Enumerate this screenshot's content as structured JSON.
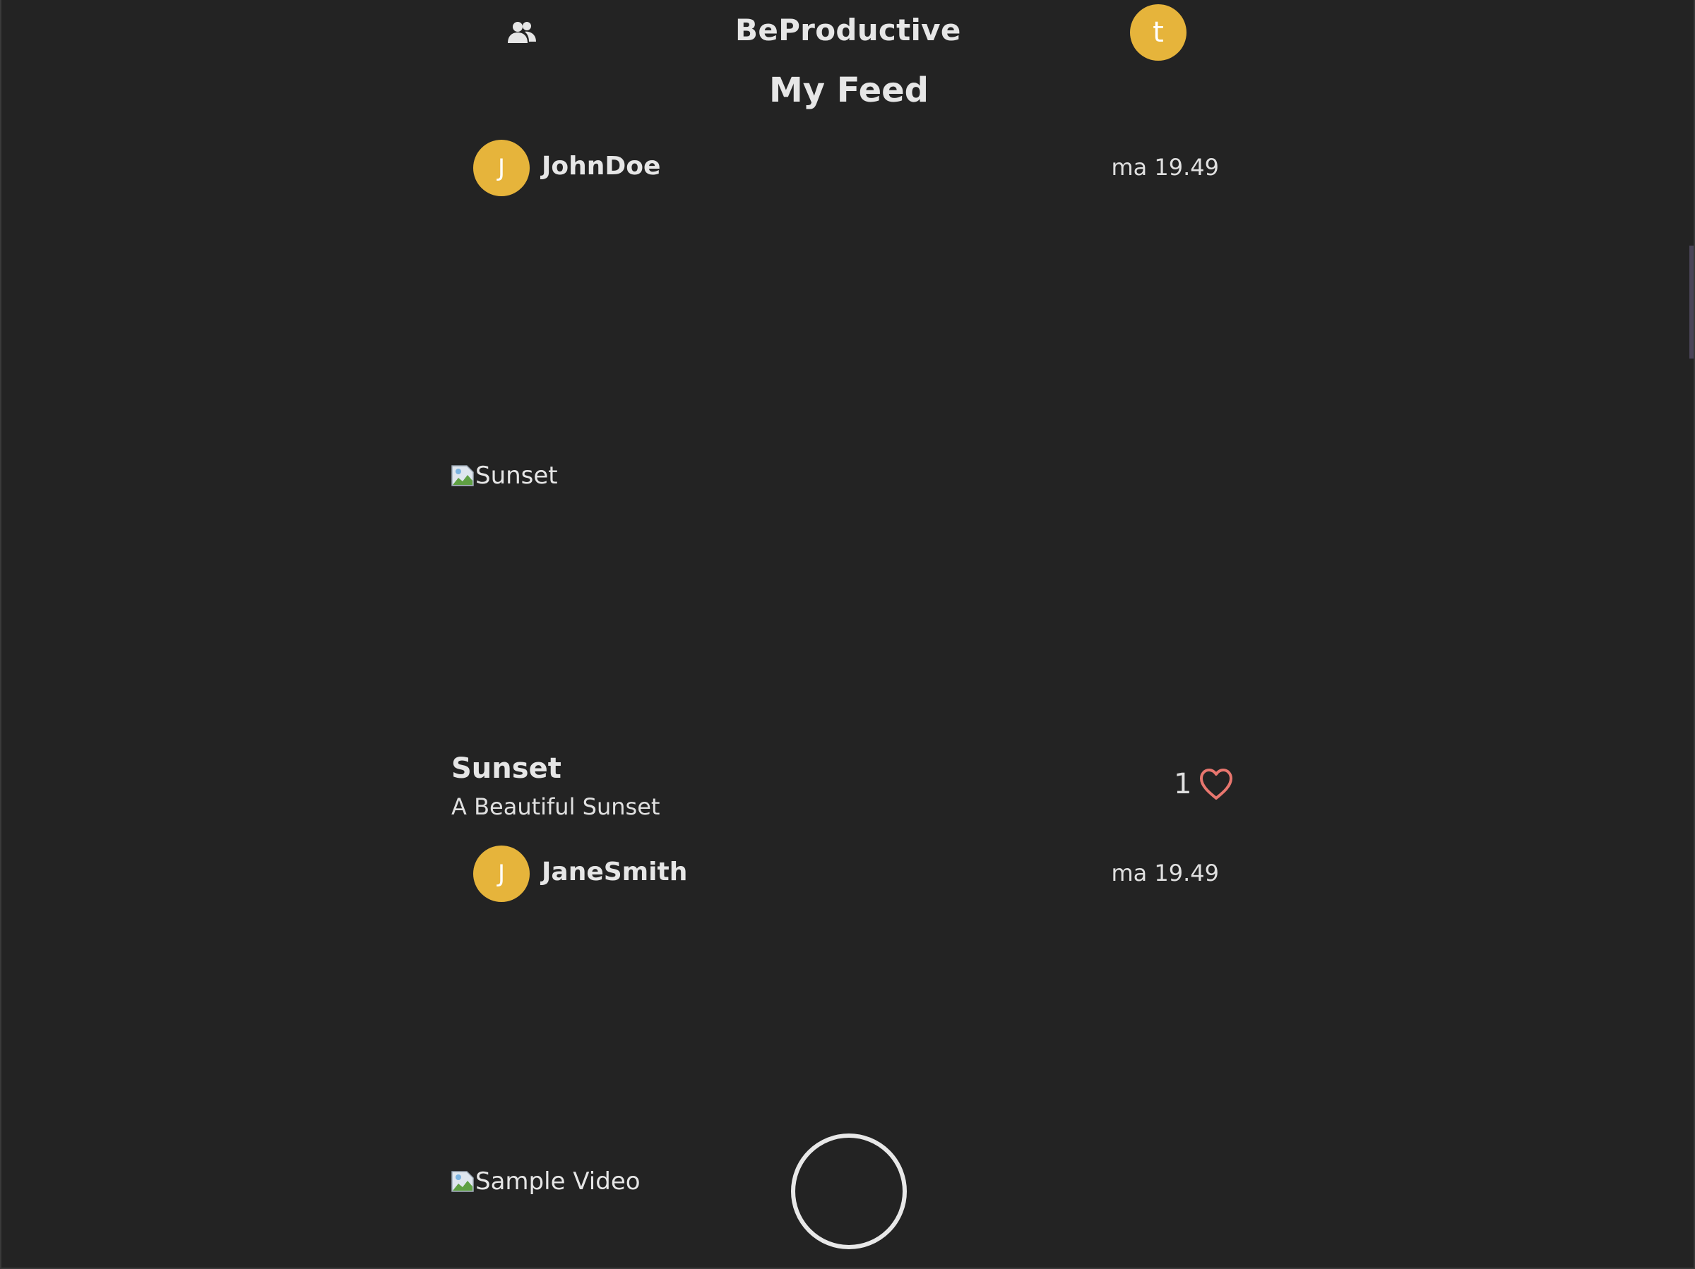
{
  "app": {
    "brand": "BeProductive",
    "user_initial": "t",
    "accent_color": "#e6b43b",
    "background_color": "#232323",
    "friends_icon": "users-icon"
  },
  "feed": {
    "title": "My Feed",
    "posts": [
      {
        "username": "JohnDoe",
        "initial": "J",
        "time": "ma 19.49",
        "media_alt": "Sunset",
        "title": "Sunset",
        "description": "A Beautiful Sunset",
        "likes": "1",
        "like_icon": "heart-icon"
      },
      {
        "username": "JaneSmith",
        "initial": "J",
        "time": "ma 19.49",
        "media_alt": "Sample Video"
      }
    ]
  },
  "capture_button": {
    "icon": "capture-circle-icon"
  }
}
